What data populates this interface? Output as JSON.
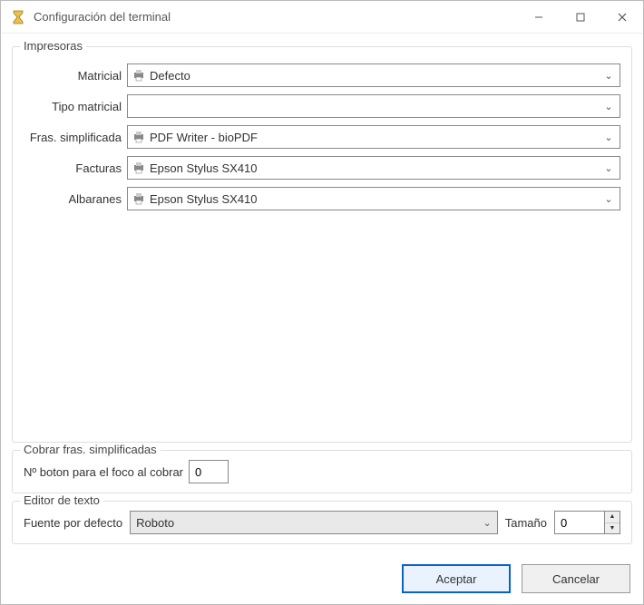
{
  "window": {
    "title": "Configuración del terminal"
  },
  "printers": {
    "legend": "Impresoras",
    "rows": {
      "matricial": {
        "label": "Matricial",
        "value": "Defecto"
      },
      "tipo_matricial": {
        "label": "Tipo matricial",
        "value": ""
      },
      "fras_simplificada": {
        "label": "Fras. simplificada",
        "value": "PDF Writer - bioPDF"
      },
      "facturas": {
        "label": "Facturas",
        "value": "Epson Stylus SX410"
      },
      "albaranes": {
        "label": "Albaranes",
        "value": "Epson Stylus SX410"
      }
    }
  },
  "cobrar": {
    "legend": "Cobrar fras. simplificadas",
    "focus_label": "Nº boton para el foco al cobrar",
    "focus_value": "0"
  },
  "editor": {
    "legend": "Editor de texto",
    "font_label": "Fuente por defecto",
    "font_value": "Roboto",
    "size_label": "Tamaño",
    "size_value": "0"
  },
  "buttons": {
    "accept": "Aceptar",
    "cancel": "Cancelar"
  }
}
